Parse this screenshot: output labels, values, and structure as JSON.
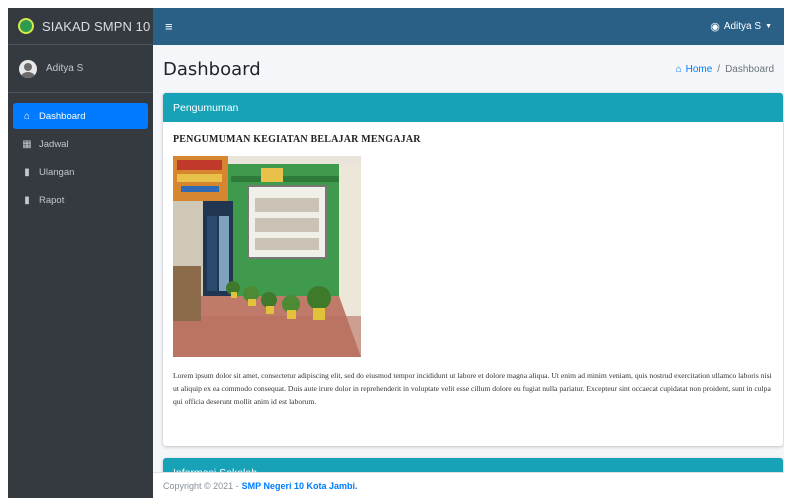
{
  "brand": {
    "name": "SIAKAD SMPN 10"
  },
  "user": {
    "name": "Aditya S",
    "menu_label": "Aditya S"
  },
  "sidebar": {
    "items": [
      {
        "label": "Dashboard",
        "icon": "home-icon",
        "active": true
      },
      {
        "label": "Jadwal",
        "icon": "calendar-icon",
        "active": false
      },
      {
        "label": "Ulangan",
        "icon": "file-icon",
        "active": false
      },
      {
        "label": "Rapot",
        "icon": "file-icon",
        "active": false
      }
    ]
  },
  "header": {
    "title": "Dashboard",
    "breadcrumb": {
      "home": "Home",
      "current": "Dashboard"
    }
  },
  "cards": {
    "announcement": {
      "header": "Pengumuman",
      "title": "PENGUMUMAN KEGIATAN BELAJAR MENGAJAR",
      "text": "Lorem ipsum dolor sit amet, consectetur adipiscing elit, sed do eiusmod tempor incididunt ut labore et dolore magna aliqua. Ut enim ad minim veniam, quis nostrud exercitation ullamco laboris nisi ut aliquip ex ea commodo consequat. Duis aute irure dolor in reprehenderit in voluptate velit esse cillum dolore eu fugiat nulla pariatur. Excepteur sint occaecat cupidatat non proident, sunt in culpa qui officia deserunt mollit anim id est laborum."
    },
    "school_info": {
      "header": "Informasi Sekolah"
    }
  },
  "footer": {
    "copyright": "Copyright © 2021 - ",
    "school": "SMP Negeri 10 Kota Jambi."
  },
  "colors": {
    "sidebar": "#343a40",
    "topbar": "#2a5f86",
    "active_nav": "#007bff",
    "card_header": "#17a2b8",
    "link": "#007bff"
  }
}
